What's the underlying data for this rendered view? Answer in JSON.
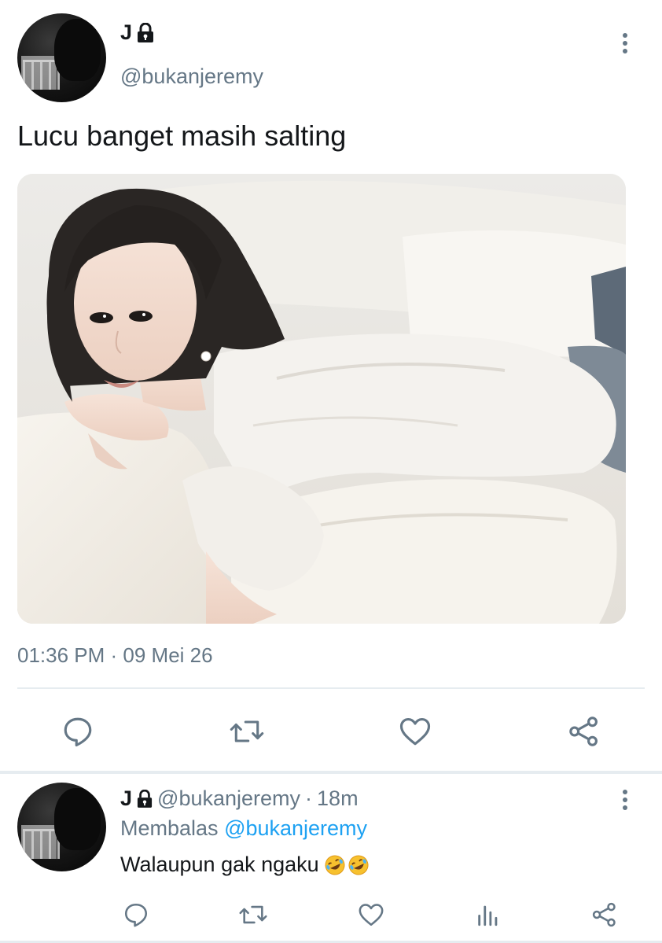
{
  "tweet": {
    "display_name": "J",
    "handle": "@bukanjeremy",
    "locked_icon": "lock-icon",
    "more_icon": "more-vertical-icon",
    "text": "Lucu banget masih salting",
    "timestamp": "01:36 PM · 09 Mei 26",
    "actions": [
      "reply-icon",
      "retweet-icon",
      "like-icon",
      "share-icon"
    ]
  },
  "reply": {
    "display_name": "J",
    "handle": "@bukanjeremy",
    "separator": "·",
    "age": "18m",
    "replying_prefix": "Membalas",
    "replying_to": "@bukanjeremy",
    "text": "Walaupun gak ngaku",
    "emoji": [
      "rolling-on-floor-laughing-emoji",
      "rolling-on-floor-laughing-emoji"
    ],
    "actions": [
      "reply-icon",
      "retweet-icon",
      "like-icon",
      "analytics-icon",
      "share-icon"
    ]
  },
  "colors": {
    "text_primary": "#14171a",
    "text_secondary": "#657786",
    "link": "#1da1f2",
    "divider": "#e6ecf0"
  }
}
